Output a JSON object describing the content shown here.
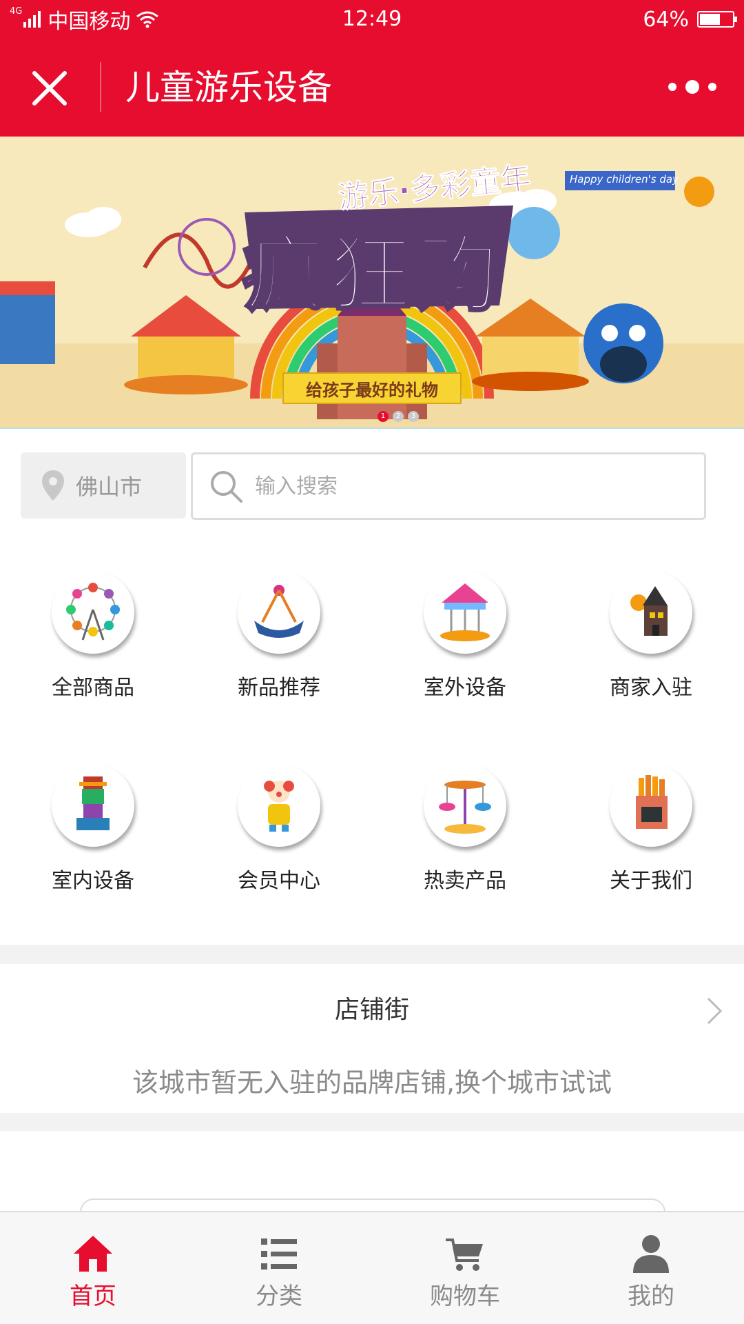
{
  "status_bar": {
    "network": "4G",
    "carrier": "中国移动",
    "time": "12:49",
    "battery": "64%",
    "battery_level": 0.64
  },
  "header": {
    "title": "儿童游乐设备",
    "accent_color": "#e60d2e"
  },
  "banner": {
    "headline": "疯狂购",
    "subtitle": "游乐·多彩童年",
    "tag": "Happy children's day",
    "ribbon": "给孩子最好的礼物",
    "pages": [
      "1",
      "2",
      "3"
    ],
    "active_page": 1
  },
  "search": {
    "city": "佛山市",
    "placeholder": "输入搜索"
  },
  "categories": [
    {
      "label": "全部商品",
      "icon": "ferris-wheel-icon"
    },
    {
      "label": "新品推荐",
      "icon": "pirate-ship-ride-icon"
    },
    {
      "label": "室外设备",
      "icon": "carousel-icon"
    },
    {
      "label": "商家入驻",
      "icon": "haunted-house-icon"
    },
    {
      "label": "室内设备",
      "icon": "totem-game-machine-icon"
    },
    {
      "label": "会员中心",
      "icon": "clown-icon"
    },
    {
      "label": "热卖产品",
      "icon": "airplane-ride-icon"
    },
    {
      "label": "关于我们",
      "icon": "food-stand-icon"
    }
  ],
  "store_street": {
    "title": "店铺街",
    "empty_message": "该城市暂无入驻的品牌店铺,换个城市试试"
  },
  "bottom_nav": {
    "items": [
      {
        "label": "首页",
        "icon": "home-icon",
        "active": true
      },
      {
        "label": "分类",
        "icon": "list-icon",
        "active": false
      },
      {
        "label": "购物车",
        "icon": "cart-icon",
        "active": false
      },
      {
        "label": "我的",
        "icon": "user-icon",
        "active": false
      }
    ],
    "active_color": "#e60d2e",
    "inactive_color": "#8a8a8a"
  }
}
